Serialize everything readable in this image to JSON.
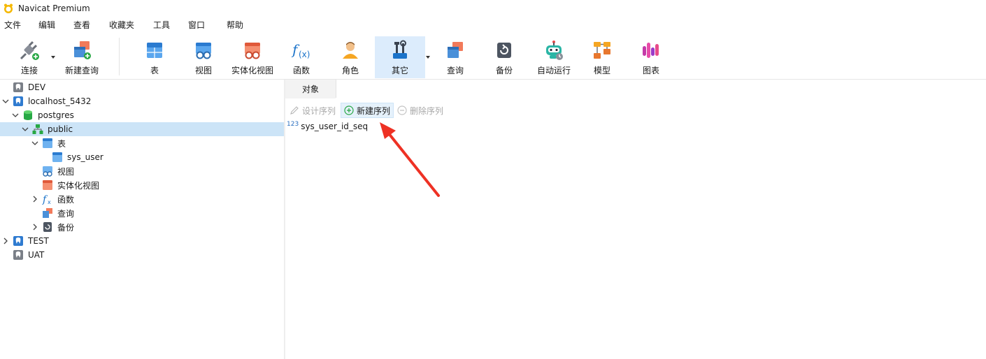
{
  "window": {
    "title": "Navicat Premium"
  },
  "menu": [
    "文件",
    "编辑",
    "查看",
    "收藏夹",
    "工具",
    "窗口",
    "帮助"
  ],
  "toolbar": {
    "connect": "连接",
    "new_query": "新建查询",
    "table": "表",
    "view": "视图",
    "mat_view": "实体化视图",
    "function": "函数",
    "role": "角色",
    "other": "其它",
    "query": "查询",
    "backup": "备份",
    "auto_run": "自动运行",
    "model": "模型",
    "chart": "图表"
  },
  "tree": {
    "dev": "DEV",
    "localhost": "localhost_5432",
    "postgres": "postgres",
    "public": "public",
    "tables": "表",
    "sys_user": "sys_user",
    "views": "视图",
    "mat_views": "实体化视图",
    "functions": "函数",
    "queries": "查询",
    "backups": "备份",
    "test": "TEST",
    "uat": "UAT"
  },
  "objects": {
    "tab": "对象",
    "design_seq": "设计序列",
    "new_seq": "新建序列",
    "delete_seq": "删除序列",
    "seq_badge": "123",
    "item": "sys_user_id_seq"
  },
  "colors": {
    "accent": "#0078d4",
    "selected_row": "#cce4f7",
    "active_tool": "#dcecfc",
    "annotation_arrow": "#ee3124"
  }
}
